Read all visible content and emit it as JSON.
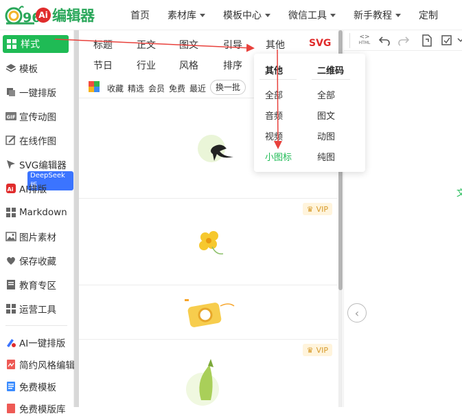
{
  "brand": {
    "logo_text": "编辑器",
    "logo_number": "96",
    "logo_ai": "Ai"
  },
  "nav": [
    {
      "label": "首页",
      "dropdown": false
    },
    {
      "label": "素材库",
      "dropdown": true
    },
    {
      "label": "模板中心",
      "dropdown": true
    },
    {
      "label": "微信工具",
      "dropdown": true
    },
    {
      "label": "新手教程",
      "dropdown": true
    },
    {
      "label": "定制",
      "dropdown": false
    }
  ],
  "sidebar": {
    "active": {
      "label": "样式",
      "icon": "grid-icon"
    },
    "items": [
      {
        "label": "模板",
        "icon": "layers-icon"
      },
      {
        "label": "一键排版",
        "icon": "copy-icon"
      },
      {
        "label": "宣传动图",
        "icon": "gif-icon"
      },
      {
        "label": "在线作图",
        "icon": "edit-icon"
      },
      {
        "label": "SVG编辑器",
        "icon": "cursor-icon"
      },
      {
        "label": "AI排版",
        "icon": "ai-icon"
      },
      {
        "label": "Markdown",
        "icon": "grid-icon"
      },
      {
        "label": "图片素材",
        "icon": "image-icon"
      },
      {
        "label": "保存收藏",
        "icon": "heart-icon"
      },
      {
        "label": "教育专区",
        "icon": "book-icon"
      },
      {
        "label": "运营工具",
        "icon": "grid-icon"
      }
    ],
    "badge": "DeepSeek版",
    "extra": [
      {
        "label": "AI一键排版",
        "icon": "ai-pen-icon"
      },
      {
        "label": "简约风格编辑",
        "icon": "doc-red-icon"
      },
      {
        "label": "免费模板",
        "icon": "doc-blue-icon"
      },
      {
        "label": "免费模版库",
        "icon": "doc-red-icon"
      }
    ]
  },
  "categories": {
    "row1": [
      "标题",
      "正文",
      "图文",
      "引导",
      "其他",
      "SVG"
    ],
    "row2": [
      "节日",
      "行业",
      "风格",
      "排序"
    ]
  },
  "filters": {
    "items": [
      "收藏",
      "精选",
      "会员",
      "免费",
      "最近"
    ],
    "refresh": "换一批"
  },
  "cards": [
    {
      "vip": false,
      "icon": "swallow-icon"
    },
    {
      "vip": true,
      "vip_label": "VIP",
      "icon": "flower-icon"
    },
    {
      "vip": false,
      "icon": "camera-icon"
    },
    {
      "vip": true,
      "vip_label": "VIP",
      "icon": "bamboo-icon"
    }
  ],
  "dropdown": {
    "col1": {
      "title": "其他",
      "items": [
        "全部",
        "音频",
        "视频",
        "小图标"
      ],
      "active": "小图标"
    },
    "col2": {
      "title": "二维码",
      "items": [
        "全部",
        "图文",
        "动图",
        "纯图"
      ]
    }
  },
  "toolbar": {
    "html_label": "HTML"
  },
  "right_panel": {
    "partial_text": "文"
  },
  "colors": {
    "accent": "#1fbb55",
    "svg_red": "#e02c2c",
    "vip_gold": "#d79a2a",
    "arrow_red": "#e8413c"
  }
}
